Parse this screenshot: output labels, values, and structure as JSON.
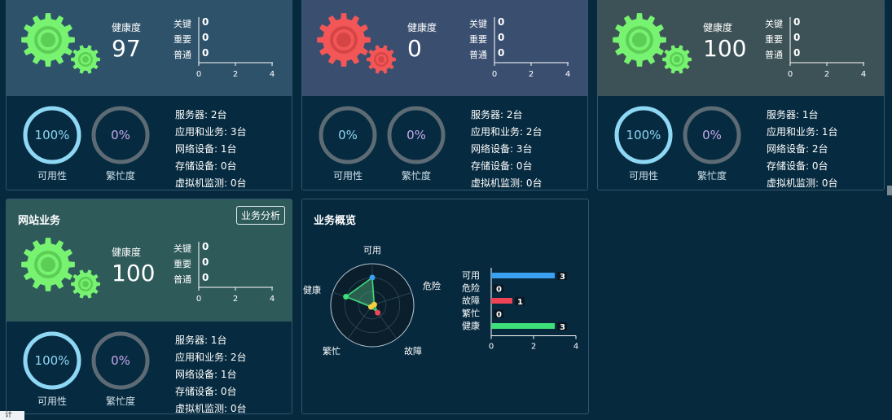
{
  "cards": [
    {
      "bg": "#2e526a",
      "gear_color": "#77f271",
      "gear_dark": "#5ccd55",
      "health_label": "健康度",
      "health_value": "97",
      "levels": [
        {
          "label": "关键",
          "value": "0"
        },
        {
          "label": "重要",
          "value": "0"
        },
        {
          "label": "普通",
          "value": "0"
        }
      ],
      "ticks": [
        "0",
        "2",
        "4"
      ],
      "availability": {
        "value": "100%",
        "label": "可用性",
        "fill": 1.0
      },
      "busy": {
        "value": "0%",
        "label": "繁忙度",
        "fill": 0
      },
      "info": [
        "服务器: 2台",
        "应用和业务: 3台",
        "网络设备: 1台",
        "存储设备: 0台",
        "虚拟机监测: 0台"
      ]
    },
    {
      "bg": "#3a4f70",
      "gear_color": "#f25656",
      "gear_dark": "#d64545",
      "health_label": "健康度",
      "health_value": "0",
      "levels": [
        {
          "label": "关键",
          "value": "0"
        },
        {
          "label": "重要",
          "value": "0"
        },
        {
          "label": "普通",
          "value": "0"
        }
      ],
      "ticks": [
        "0",
        "2",
        "4"
      ],
      "availability": {
        "value": "0%",
        "label": "可用性",
        "fill": 0
      },
      "busy": {
        "value": "0%",
        "label": "繁忙度",
        "fill": 0
      },
      "info": [
        "服务器: 2台",
        "应用和业务: 2台",
        "网络设备: 3台",
        "存储设备: 0台",
        "虚拟机监测: 0台"
      ]
    },
    {
      "bg": "#3d5256",
      "gear_color": "#77f271",
      "gear_dark": "#5ccd55",
      "health_label": "健康度",
      "health_value": "100",
      "levels": [
        {
          "label": "关键",
          "value": "0"
        },
        {
          "label": "重要",
          "value": "0"
        },
        {
          "label": "普通",
          "value": "0"
        }
      ],
      "ticks": [
        "0",
        "2",
        "4"
      ],
      "availability": {
        "value": "100%",
        "label": "可用性",
        "fill": 1.0
      },
      "busy": {
        "value": "0%",
        "label": "繁忙度",
        "fill": 0
      },
      "info": [
        "服务器: 1台",
        "应用和业务: 1台",
        "网络设备: 2台",
        "存储设备: 0台",
        "虚拟机监测: 0台"
      ]
    },
    {
      "title": "网站业务",
      "button": "业务分析",
      "bg": "#2f5a5a",
      "gear_color": "#77f271",
      "gear_dark": "#5ccd55",
      "health_label": "健康度",
      "health_value": "100",
      "levels": [
        {
          "label": "关键",
          "value": "0"
        },
        {
          "label": "重要",
          "value": "0"
        },
        {
          "label": "普通",
          "value": "0"
        }
      ],
      "ticks": [
        "0",
        "2",
        "4"
      ],
      "availability": {
        "value": "100%",
        "label": "可用性",
        "fill": 1.0
      },
      "busy": {
        "value": "0%",
        "label": "繁忙度",
        "fill": 0
      },
      "info": [
        "服务器: 1台",
        "应用和业务: 2台",
        "网络设备: 1台",
        "存储设备: 0台",
        "虚拟机监测: 0台"
      ]
    }
  ],
  "overview": {
    "title": "业务概览",
    "radar_labels": [
      "可用",
      "危险",
      "故障",
      "繁忙",
      "健康"
    ],
    "bar_labels": [
      "可用",
      "危险",
      "故障",
      "繁忙",
      "健康"
    ],
    "ticks": [
      "0",
      "2",
      "4"
    ]
  },
  "chart_data": [
    {
      "type": "radar",
      "categories": [
        "可用",
        "危险",
        "故障",
        "繁忙",
        "健康"
      ],
      "values": [
        3,
        0,
        1,
        0,
        3
      ],
      "colors": [
        "#3aa0f0",
        "#f0d040",
        "#ee4455",
        "#f0d040",
        "#3ee07a"
      ]
    },
    {
      "type": "bar",
      "orientation": "horizontal",
      "categories": [
        "可用",
        "危险",
        "故障",
        "繁忙",
        "健康"
      ],
      "values": [
        3,
        0,
        1,
        0,
        3
      ],
      "colors": [
        "#3aa0f0",
        "#f0d040",
        "#ee4455",
        "#f0d040",
        "#3ee07a"
      ],
      "xlim": [
        0,
        4
      ]
    }
  ],
  "misc": {
    "corner_text": "计"
  }
}
